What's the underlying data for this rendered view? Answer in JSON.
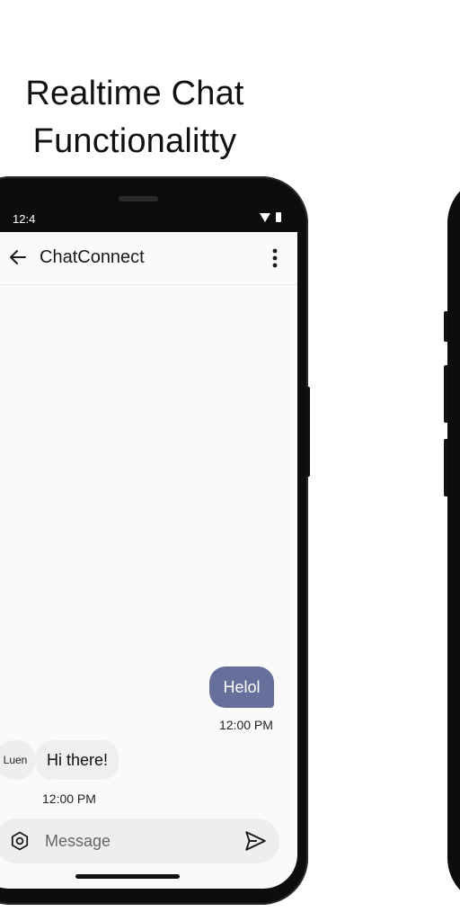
{
  "headline": {
    "line1": "Realtime Chat",
    "line2": "Functionalitty"
  },
  "status_bar": {
    "time": "12:4",
    "icons": [
      "wifi-icon",
      "battery-icon"
    ]
  },
  "app_bar": {
    "title": "ChatConnect",
    "back_icon": "arrow-left-icon",
    "menu_icon": "more-vert-icon"
  },
  "messages": [
    {
      "direction": "outgoing",
      "text": "Helol",
      "time": "12:00 PM"
    },
    {
      "direction": "incoming",
      "sender": "Luen",
      "text": "Hi there!",
      "time": "12:00 PM"
    }
  ],
  "composer": {
    "placeholder": "Message",
    "value": "",
    "left_icon": "gear-icon",
    "send_icon": "send-icon"
  },
  "colors": {
    "outgoing_bubble": "#67709b",
    "incoming_bubble": "#efefef",
    "screen_background": "#fafafa",
    "phone_frame": "#0d0d0d"
  }
}
